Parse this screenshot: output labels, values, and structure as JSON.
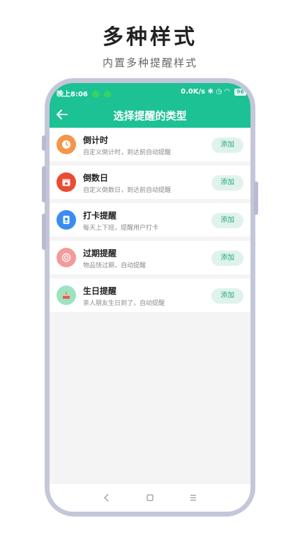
{
  "promo": {
    "title": "多种样式",
    "subtitle": "内置多种提醒样式"
  },
  "status_bar": {
    "time": "晚上8:06",
    "speed": "0.0K/s",
    "battery": "96"
  },
  "toolbar": {
    "title": "选择提醒的类型"
  },
  "items": [
    {
      "name": "倒计时",
      "desc": "自定义倒计时，到达前自动提醒",
      "button": "添加",
      "icon": "clock-icon",
      "color": "#f5964b"
    },
    {
      "name": "倒数日",
      "desc": "自定义倒数日，到达前自动提醒",
      "button": "添加",
      "icon": "calendar-icon",
      "color": "#e94b33"
    },
    {
      "name": "打卡提醒",
      "desc": "每天上下班，提醒用户打卡",
      "button": "添加",
      "icon": "clock-in-icon",
      "color": "#3b8cf0"
    },
    {
      "name": "过期提醒",
      "desc": "物品快过期，自动提醒",
      "button": "添加",
      "icon": "expire-icon",
      "color": "#f59a99"
    },
    {
      "name": "生日提醒",
      "desc": "亲人朋友生日到了，自动提醒",
      "button": "添加",
      "icon": "cake-icon",
      "color": "#9ee3bf"
    }
  ],
  "colors": {
    "accent": "#1cc194",
    "button_bg": "#dff3ec",
    "button_text": "#2aa77f"
  }
}
